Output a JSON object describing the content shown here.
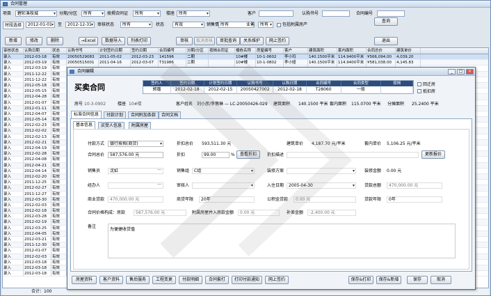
{
  "window": {
    "title": "合同管理"
  },
  "filters": {
    "xiangmu_label": "项目",
    "xiangmu_value": "碧彩溪枝城",
    "fenqi_label": "分期/分区",
    "fenqi_value": "所有",
    "anjie_label": "按揭合同证",
    "anjie_value": "所有",
    "loudong_label": "楼座",
    "loudong_value": "所有",
    "kehu_label": "客户",
    "kehu_value": "",
    "rengou_label": "认购书号",
    "rengou_value": "",
    "hetong_label": "合同编号",
    "hetong_value": "",
    "shijian_label": "时段选择",
    "date_from": "2012-01-01",
    "zhi_label": "至",
    "date_to": "2012-12-31",
    "shenhe_label": "审核状态",
    "shenhe_value": "所有",
    "zhuangtai_label": "状态",
    "zhuangtai_value": "有效",
    "jiaoshou_label": "销售情况",
    "jiaoshou_value": "所有",
    "yewu_label": "业务",
    "yewu_value": "所有",
    "include_label": "包括附属房产"
  },
  "toolbar": {
    "add": "新增",
    "edit": "修改",
    "delete": "删除",
    "excel": "→Excel",
    "data_import": "数据导入",
    "list_print": "列表打印",
    "audit": "审核",
    "cancel_audit": "取消审核",
    "audit_query": "审批查询",
    "query": "查询",
    "relation": "关系维护",
    "online_sign": "网上签约",
    "exit": "退出"
  },
  "grid": {
    "headers": [
      "审核状态",
      "认购日期",
      "状态",
      "认购书号",
      "计划签约日期",
      "签约日期",
      "合同编号",
      "分期/分区",
      "按揭合同证",
      "楼栋名称",
      "房屋编号",
      "客户",
      "建筑面积",
      "套内面积",
      "合同总价",
      "建筑单价"
    ],
    "rows": [
      [
        "录入",
        "2012-03-18",
        "有效",
        "20050529083",
        "2011-05-02",
        "2012-03-23",
        "141596",
        "二期",
        "",
        "10#楼",
        "10-1-0602",
        "李小玛",
        "140.1500平米",
        "114.9400平米",
        "¥566,094.00",
        "4,039.20"
      ],
      [
        "录入",
        "2012-03-19",
        "有效",
        "20050515001",
        "2011-04-16",
        "2012-03-07",
        "T31986",
        "二期",
        "",
        "10#楼",
        "10-1-0802",
        "李小娅",
        "140.1500平米",
        "114.9400平米",
        "¥581,038.00",
        "4,145.83"
      ],
      [
        "录入",
        "2012-03-19",
        "有效",
        "",
        "",
        "",
        "",
        "",
        "",
        "",
        "",
        "",
        "",
        "",
        "",
        ""
      ],
      [
        "录入",
        "2011-12-22",
        "有效",
        "",
        "",
        "",
        "",
        "",
        "",
        "",
        "",
        "",
        "",
        "",
        "",
        ""
      ],
      [
        "录入",
        "2011-12-22",
        "有效",
        "",
        "",
        "",
        "",
        "",
        "",
        "",
        "",
        "",
        "",
        "",
        "",
        ""
      ],
      [
        "录入",
        "2012-05-18",
        "有效",
        "",
        "",
        "",
        "",
        "",
        "",
        "",
        "",
        "",
        "",
        "",
        "",
        ""
      ],
      [
        "录入",
        "2012-05-15",
        "有效",
        "",
        "",
        "",
        "",
        "",
        "",
        "",
        "",
        "",
        "",
        "",
        "",
        ""
      ],
      [
        "录入",
        "2012-04-28",
        "有效",
        "",
        "",
        "",
        "",
        "",
        "",
        "",
        "",
        "",
        "",
        "",
        "",
        ""
      ],
      [
        "录入",
        "2012-01-07",
        "有效",
        "",
        "",
        "",
        "",
        "",
        "",
        "",
        "",
        "",
        "",
        "",
        "",
        ""
      ],
      [
        "录入",
        "2012-01-11",
        "有效",
        "",
        "",
        "",
        "",
        "",
        "",
        "",
        "",
        "",
        "",
        "",
        "",
        ""
      ],
      [
        "录入",
        "2012-04-07",
        "有效",
        "",
        "",
        "",
        "",
        "",
        "",
        "",
        "",
        "",
        "",
        "",
        "",
        ""
      ],
      [
        "录入",
        "2012-05-14",
        "有效",
        "",
        "",
        "",
        "",
        "",
        "",
        "",
        "",
        "",
        "",
        "",
        "",
        ""
      ],
      [
        "录入",
        "2012-02-23",
        "有效",
        "",
        "",
        "",
        "",
        "",
        "",
        "",
        "",
        "",
        "",
        "",
        "",
        ""
      ],
      [
        "录入",
        "2012-02-02",
        "有效",
        "",
        "",
        "",
        "",
        "",
        "",
        "",
        "",
        "",
        "",
        "",
        "",
        ""
      ],
      [
        "录入",
        "2012-02-13",
        "有效",
        "",
        "",
        "",
        "",
        "",
        "",
        "",
        "",
        "",
        "",
        "",
        "",
        ""
      ],
      [
        "录入",
        "2012-02-21",
        "有效",
        "",
        "",
        "",
        "",
        "",
        "",
        "",
        "",
        "",
        "",
        "",
        "",
        ""
      ],
      [
        "录入",
        "2012-04-19",
        "有效",
        "",
        "",
        "",
        "",
        "",
        "",
        "",
        "",
        "",
        "",
        "",
        "",
        ""
      ],
      [
        "录入",
        "2012-02-28",
        "有效",
        "",
        "",
        "",
        "",
        "",
        "",
        "",
        "",
        "",
        "",
        "",
        "",
        ""
      ],
      [
        "录入",
        "2012-04-08",
        "有效",
        "",
        "",
        "",
        "",
        "",
        "",
        "",
        "",
        "",
        "",
        "",
        "",
        ""
      ],
      [
        "录入",
        "2012-04-21",
        "有效",
        "",
        "",
        "",
        "",
        "",
        "",
        "",
        "",
        "",
        "",
        "",
        "",
        ""
      ],
      [
        "录入",
        "2012-04-14",
        "有效",
        "",
        "",
        "",
        "",
        "",
        "",
        "",
        "",
        "",
        "",
        "",
        "",
        ""
      ],
      [
        "录入",
        "2012-02-20",
        "有效",
        "",
        "",
        "",
        "",
        "",
        "",
        "",
        "",
        "",
        "",
        "",
        "",
        ""
      ],
      [
        "录入",
        "2011-12-25",
        "有效",
        "",
        "",
        "",
        "",
        "",
        "",
        "",
        "",
        "",
        "",
        "",
        "",
        ""
      ],
      [
        "录入",
        "2012-02-27",
        "有效",
        "",
        "",
        "",
        "",
        "",
        "",
        "",
        "",
        "",
        "",
        "",
        "",
        ""
      ],
      [
        "录入",
        "2011-12-27",
        "有效",
        "",
        "",
        "",
        "",
        "",
        "",
        "",
        "",
        "",
        "",
        "",
        "",
        ""
      ],
      [
        "录入",
        "2012-03-30",
        "有效",
        "",
        "",
        "",
        "",
        "",
        "",
        "",
        "",
        "",
        "",
        "",
        "",
        ""
      ],
      [
        "录入",
        "2012-02-03",
        "有效",
        "",
        "",
        "",
        "",
        "",
        "",
        "",
        "",
        "",
        "",
        "",
        "",
        ""
      ],
      [
        "录入",
        "2012-02-18",
        "有效",
        "",
        "",
        "",
        "",
        "",
        "",
        "",
        "",
        "",
        "",
        "",
        "",
        ""
      ],
      [
        "录入",
        "2012-03-28",
        "有效",
        "",
        "",
        "",
        "",
        "",
        "",
        "",
        "",
        "",
        "",
        "",
        "",
        ""
      ],
      [
        "录入",
        "2012-02-19",
        "有效",
        "",
        "",
        "",
        "",
        "",
        "",
        "",
        "",
        "",
        "",
        "",
        "",
        ""
      ],
      [
        "录入",
        "2012-03-25",
        "有效",
        "",
        "",
        "",
        "",
        "",
        "",
        "",
        "",
        "",
        "",
        "",
        "",
        ""
      ],
      [
        "录入",
        "2012-04-05",
        "有效",
        "",
        "",
        "",
        "",
        "",
        "",
        "",
        "",
        "",
        "",
        "",
        "",
        ""
      ],
      [
        "录入",
        "2012-03-21",
        "有效",
        "",
        "",
        "",
        "",
        "",
        "",
        "",
        "",
        "",
        "",
        "",
        "",
        ""
      ],
      [
        "录入",
        "2011-12-30",
        "有效",
        "",
        "",
        "",
        "",
        "",
        "",
        "",
        "",
        "",
        "",
        "",
        "",
        ""
      ],
      [
        "录入",
        "2012-01-07",
        "有效",
        "",
        "",
        "",
        "",
        "",
        "",
        "",
        "",
        "",
        "",
        "",
        "",
        ""
      ],
      [
        "录入",
        "2012-02-03",
        "有效",
        "",
        "",
        "",
        "",
        "",
        "",
        "",
        "",
        "",
        "",
        "",
        "",
        ""
      ],
      [
        "录入",
        "2012-03-18",
        "有效",
        "",
        "",
        "",
        "",
        "",
        "",
        "",
        "",
        "",
        "",
        "",
        "",
        ""
      ],
      [
        "录入",
        "2012-03-18",
        "有效",
        "",
        "",
        "",
        "",
        "",
        "",
        "",
        "",
        "",
        "",
        "",
        "",
        ""
      ],
      [
        "录入",
        "2012-03-18",
        "有效",
        "",
        "",
        "",
        "",
        "",
        "",
        "",
        "",
        "",
        "",
        "",
        "",
        ""
      ]
    ],
    "footer": "合计：100"
  },
  "dialog": {
    "title": "合同编辑",
    "heading": "买卖合同",
    "mini_headers": [
      "签约人",
      "签约日期",
      "计划签约日期",
      "认购书号",
      "认购日期",
      "合同编号",
      "合同类型",
      "按揭"
    ],
    "mini_values": [
      "郭璐",
      "2012-02-18",
      "2012-02-15",
      "20050427002",
      "2012-02-18",
      "T28060",
      "一般",
      ""
    ],
    "chk_huiqian": "回迁房",
    "chk_dikou": "抵扣房",
    "fanghao_label": "房号",
    "fanghao": "10-3-0902",
    "loudong_label": "楼座",
    "loudong": "10#楼",
    "kehu_label": "客户姓名",
    "kehu": "刘小彦/李蔡琳 — LC-20050426-029",
    "jianmian_label": "建筑面积",
    "jianmian": "140.1500 平米",
    "taomian_label": "套内面积",
    "taomian": "115.0700 平米",
    "fentan_label": "分摊面积",
    "fentan": "25.2400 平米",
    "tabs": [
      "标准合同信息",
      "付款计划",
      "合同附加条款",
      "合同文档"
    ],
    "subtabs": [
      "基本信息",
      "买受人信息",
      "附属房屋"
    ],
    "fukuan_label": "付款方式",
    "fukuan": "银行按揭(商贷)",
    "zhekou_zongjia_label": "折扣总价",
    "zhekou_zongjia": "593,511.30 元",
    "jianzhu_danjia_label": "建筑单价",
    "jianzhu_danjia": "4,187.70 元/平米",
    "taonei_danjia_label": "套内单价",
    "taonei_danjia": "5,106.25 元/平米",
    "hetong_zongjia_label": "合同总价",
    "hetong_zongjia": "587,576.00 元",
    "zhekou_label": "折扣",
    "zhekou": "99.00",
    "pct": "%",
    "view_zhekou": "查看折扣",
    "zhekou_desc_label": "折扣描述",
    "update_price": "更新报价",
    "xiaoshou_label": "销售员",
    "xiaoshou": "沈虹",
    "xiaoshou_zu_label": "销售组",
    "xiaoshou_zu": "C组",
    "zhuangxiu_label": "装修方案",
    "zhuangxiu": "",
    "zhuangxiu_jine_label": "装修金额",
    "zhuangxiu_jine": "0.00 元",
    "jingban_label": "经办人",
    "jingban": "",
    "shenhe_label": "审核人",
    "shenhe": "",
    "ruzhu_label": "入住日期",
    "ruzhu": "2005-04-30",
    "daikuan_label": "贷款总额",
    "daikuan": "470,000.00 元",
    "shangye_label": "商业贷款",
    "shangye": "470,000.00 元",
    "shangye_nian_label": "商贷年限",
    "shangye_nian": "20年",
    "gongjijin_label": "公积金贷款",
    "gongjijin": "0.00 元",
    "gjj_nian_label": "贷款年限",
    "gjj_nian": "0年",
    "hetong_jiage_label": "合同价格构成：房款",
    "hetong_jiage": "587,576.00 元",
    "fushu_label": "附属房屋并入房款金额",
    "fushu": "0.00 元",
    "buchajia_label": "补差金额",
    "buchajia": "-2,400.00 元",
    "beizhu_label": "备注",
    "beizhu": "为便捷收贷值",
    "bottom_buttons": [
      "房屋资料",
      "客户资料",
      "售后服务",
      "工程变更",
      "付款明细",
      "合同套打",
      "打印付款通知",
      "网上签约"
    ],
    "save_print": "保存&打印",
    "save_new": "保存&新增",
    "save": "保存",
    "cancel": "取消"
  }
}
